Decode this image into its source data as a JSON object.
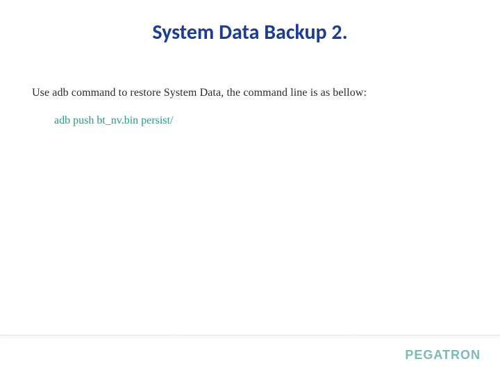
{
  "title": "System Data Backup 2.",
  "body": "Use adb command to restore System Data, the command line is as bellow:",
  "command": "adb push bt_nv.bin persist/",
  "brand": "PEGATRON"
}
